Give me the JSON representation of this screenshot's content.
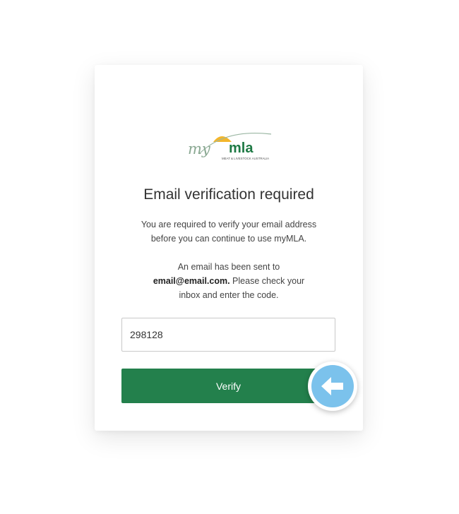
{
  "logo": {
    "brand_my": "my",
    "brand_mla": "mla",
    "tagline": "MEAT & LIVESTOCK AUSTRALIA"
  },
  "card": {
    "title": "Email verification required",
    "paragraph1_line1": "You are required to verify your email address",
    "paragraph1_line2": "before you can continue to use myMLA.",
    "paragraph2_line1": "An email has been sent to",
    "email": "email@email.com.",
    "paragraph2_line2_rest": " Please check your",
    "paragraph2_line3": "inbox and enter the code."
  },
  "code_input": {
    "value": "298128"
  },
  "verify_button": {
    "label": "Verify"
  },
  "colors": {
    "primary_green": "#23804c",
    "arrow_badge": "#7bc2ec",
    "logo_sun": "#f3b62b"
  },
  "icons": {
    "pointer": "arrow-left-icon"
  }
}
